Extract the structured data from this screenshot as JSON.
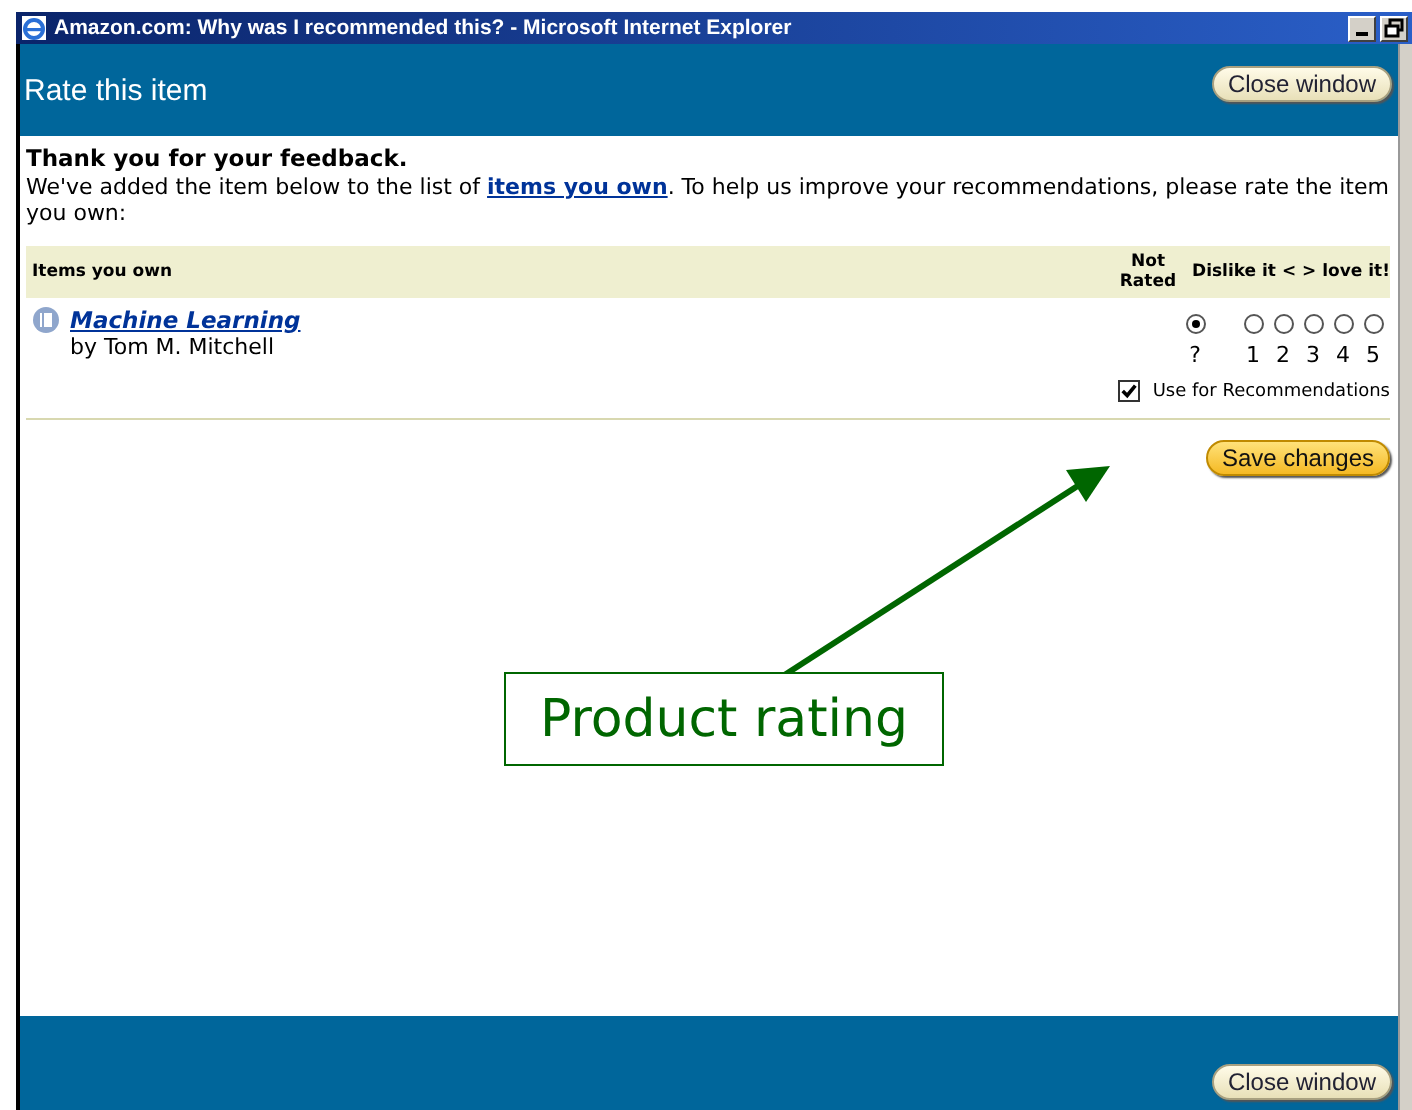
{
  "window": {
    "title": "Amazon.com: Why was I recommended this? - Microsoft Internet Explorer"
  },
  "header": {
    "title": "Rate this item",
    "button": "Close window"
  },
  "message": {
    "heading": "Thank you for your feedback.",
    "text_before": "We've added the item below to the list of ",
    "link": "items you own",
    "text_after": ". To help us improve your recommendations, please rate the item you own:"
  },
  "table": {
    "columns": [
      "Items you own",
      "Not Rated",
      "Dislike it < > love it!"
    ],
    "rows": [
      {
        "title": "Machine Learning",
        "author": "by Tom M. Mitchell",
        "ratings": [
          {
            "label": "?",
            "selected": true
          },
          {
            "label": "1",
            "selected": false
          },
          {
            "label": "2",
            "selected": false
          },
          {
            "label": "3",
            "selected": false
          },
          {
            "label": "4",
            "selected": false
          },
          {
            "label": "5",
            "selected": false
          }
        ],
        "use_for_recommendations": {
          "label": "Use for Recommendations",
          "checked": true
        }
      }
    ]
  },
  "save_button": "Save changes",
  "annotation": {
    "text": "Product rating"
  },
  "footer": {
    "button": "Close window"
  }
}
